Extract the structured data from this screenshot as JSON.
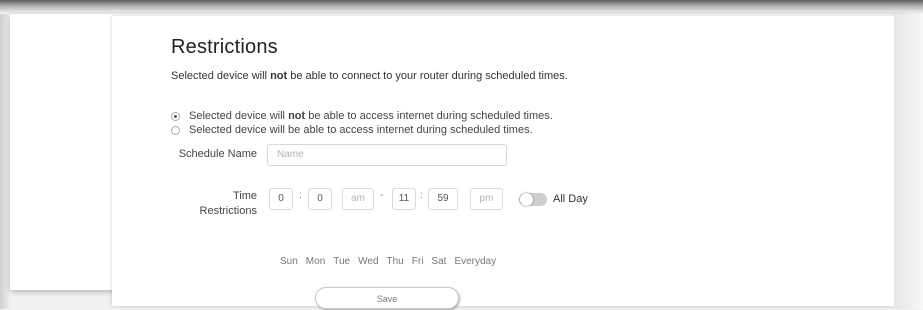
{
  "restrictions": {
    "title": "Restrictions",
    "subtitle_pre": "Selected device will ",
    "subtitle_bold": "not",
    "subtitle_post": " be able to connect to your router during scheduled times."
  },
  "options": [
    {
      "pre": "Selected device will ",
      "bold": "not",
      "post": " be able to access internet during scheduled times.",
      "checked": true
    },
    {
      "text": "Selected device will be able to access internet during scheduled times.",
      "checked": false
    }
  ],
  "schedule_name": {
    "label": "Schedule Name",
    "placeholder": "Name"
  },
  "time": {
    "label_line1": "Time",
    "label_line2": "Restrictions",
    "start_hour": "0",
    "start_minute": "0",
    "start_ampm": "am",
    "end_hour": "11",
    "end_minute": "59",
    "end_ampm": "pm",
    "range_separator": "-",
    "colon": ":"
  },
  "all_day": {
    "label": "All Day",
    "on": false
  },
  "days": [
    "Sun",
    "Mon",
    "Tue",
    "Wed",
    "Thu",
    "Fri",
    "Sat",
    "Everyday"
  ],
  "save_label": "Save"
}
